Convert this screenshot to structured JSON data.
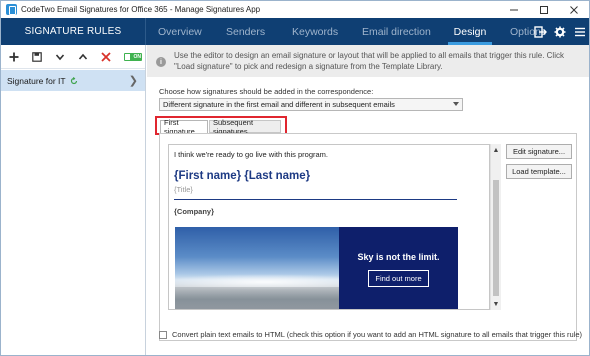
{
  "window": {
    "title": "CodeTwo Email Signatures for Office 365 - Manage Signatures App",
    "controls": [
      "minimize",
      "maximize",
      "close"
    ]
  },
  "header": {
    "section_title": "SIGNATURE RULES",
    "tabs": [
      {
        "label": "Overview",
        "active": false
      },
      {
        "label": "Senders",
        "active": false
      },
      {
        "label": "Keywords",
        "active": false
      },
      {
        "label": "Email direction",
        "active": false
      },
      {
        "label": "Design",
        "active": true
      },
      {
        "label": "Options",
        "active": false
      }
    ],
    "icons": [
      "sign-out-icon",
      "gear-icon",
      "hamburger-menu-icon"
    ]
  },
  "sidebar": {
    "toolbar": {
      "icons": [
        "add-icon",
        "save-icon",
        "move-down-icon",
        "move-up-icon",
        "delete-icon"
      ],
      "toggle_label": "ON"
    },
    "rules": [
      {
        "label": "Signature for IT",
        "selected": true
      }
    ]
  },
  "main": {
    "info_text": "Use the editor to design an email signature or layout that will be applied to all emails that trigger this rule. Click \"Load signature\" to pick and redesign a signature from the Template Library.",
    "mode_label": "Choose how signatures should be added in the correspondence:",
    "mode_value": "Different signature in the first email and different in subsequent emails",
    "subtabs": [
      {
        "label": "First signature",
        "active": true
      },
      {
        "label": "Subsequent signatures",
        "active": false
      }
    ],
    "editor": {
      "intro": "I think we're ready to go live with this program.",
      "full_name": "{First name} {Last name}",
      "title": "{Title}",
      "company": "{Company}",
      "banner_headline": "Sky is not the limit.",
      "banner_button": "Find out more"
    },
    "buttons": {
      "edit_signature": "Edit signature...",
      "load_template": "Load template..."
    },
    "convert_label": "Convert plain text emails to HTML (check this option if you want to add an HTML signature to all emails that trigger this rule)"
  },
  "colors": {
    "header_bg": "#0f3f73",
    "active_tab_underline": "#3a9be0",
    "selected_rule_bg": "#cfe1f3",
    "highlight_border": "#e0262f",
    "signature_name": "#1d3a84",
    "banner_bg": "#0e1f6b",
    "toggle_on": "#3fb24f"
  }
}
